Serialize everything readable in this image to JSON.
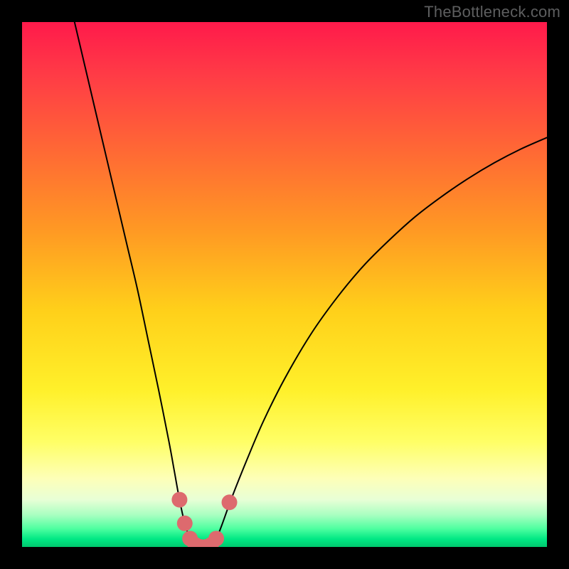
{
  "watermark": "TheBottleneck.com",
  "gradient_stops": [
    {
      "offset": 0.0,
      "color": "#ff1a4b"
    },
    {
      "offset": 0.1,
      "color": "#ff3b46"
    },
    {
      "offset": 0.25,
      "color": "#ff6a34"
    },
    {
      "offset": 0.4,
      "color": "#ff9a23"
    },
    {
      "offset": 0.55,
      "color": "#ffd01a"
    },
    {
      "offset": 0.7,
      "color": "#fff02a"
    },
    {
      "offset": 0.8,
      "color": "#ffff66"
    },
    {
      "offset": 0.87,
      "color": "#fdffb8"
    },
    {
      "offset": 0.91,
      "color": "#e8ffd6"
    },
    {
      "offset": 0.94,
      "color": "#a6ffc0"
    },
    {
      "offset": 0.965,
      "color": "#4fffa0"
    },
    {
      "offset": 0.985,
      "color": "#00e884"
    },
    {
      "offset": 1.0,
      "color": "#00c86e"
    }
  ],
  "chart_data": {
    "type": "line",
    "title": "",
    "xlabel": "",
    "ylabel": "",
    "xlim": [
      0,
      100
    ],
    "ylim": [
      0,
      100
    ],
    "series": [
      {
        "name": "bottleneck-curve",
        "x": [
          10.0,
          12.0,
          14.0,
          16.0,
          18.0,
          20.0,
          22.0,
          24.0,
          26.0,
          28.0,
          29.0,
          30.0,
          31.0,
          32.0,
          33.0,
          34.0,
          35.0,
          36.0,
          37.0,
          38.0,
          40.0,
          43.0,
          46.0,
          50.0,
          55.0,
          60.0,
          65.0,
          70.0,
          75.0,
          80.0,
          85.0,
          90.0,
          95.0,
          100.0
        ],
        "y": [
          100.0,
          91.5,
          83.0,
          74.5,
          66.0,
          57.5,
          49.0,
          39.5,
          30.0,
          20.0,
          14.5,
          9.0,
          4.5,
          1.6,
          0.4,
          0.0,
          0.0,
          0.4,
          1.6,
          4.0,
          9.5,
          17.0,
          24.0,
          32.0,
          40.5,
          47.5,
          53.5,
          58.5,
          63.0,
          66.8,
          70.2,
          73.2,
          75.8,
          78.0
        ]
      }
    ],
    "markers": [
      {
        "name": "pink-dot-left-1",
        "x": 30.0,
        "y": 9.0
      },
      {
        "name": "pink-dot-left-2",
        "x": 31.0,
        "y": 4.5
      },
      {
        "name": "pink-dot-left-3",
        "x": 32.0,
        "y": 1.6
      },
      {
        "name": "pink-dot-mid-1",
        "x": 33.0,
        "y": 0.4
      },
      {
        "name": "pink-dot-mid-2",
        "x": 34.0,
        "y": 0.0
      },
      {
        "name": "pink-dot-mid-3",
        "x": 35.0,
        "y": 0.0
      },
      {
        "name": "pink-dot-mid-4",
        "x": 36.0,
        "y": 0.4
      },
      {
        "name": "pink-dot-right-1",
        "x": 37.0,
        "y": 1.6
      },
      {
        "name": "pink-dot-right-2",
        "x": 39.5,
        "y": 8.5
      }
    ],
    "marker_style": {
      "radius_px": 11,
      "fill": "#dd6a6e"
    }
  }
}
